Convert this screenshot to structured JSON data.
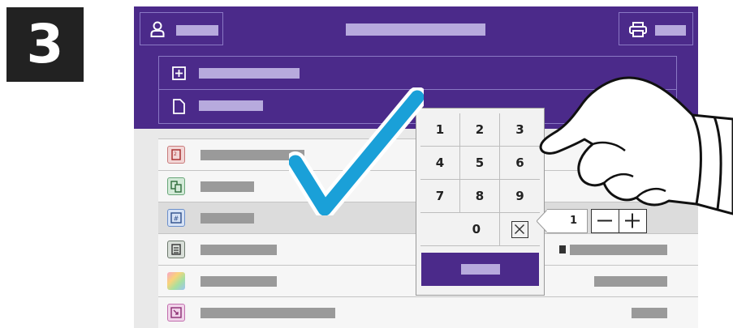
{
  "step_number": "3",
  "keypad": {
    "keys": [
      "1",
      "2",
      "3",
      "4",
      "5",
      "6",
      "7",
      "8",
      "9"
    ],
    "zero": "0"
  },
  "quantity": {
    "value": "1"
  },
  "colors": {
    "header": "#4b2a8a",
    "checkmark": "#1aa0d8",
    "panel": "#e9e9e9"
  },
  "icons": {
    "user": "user-icon",
    "printer": "printer-icon",
    "add": "plus-square-icon",
    "document": "document-icon",
    "sides": "two-sided-icon",
    "collate": "collate-icon",
    "copies": "hash-icon",
    "layout": "page-layout-icon",
    "color": "color-icon",
    "reduce": "reduce-enlarge-icon",
    "clear": "clear-icon",
    "hand": "pointing-hand-icon",
    "check": "checkmark-icon"
  }
}
